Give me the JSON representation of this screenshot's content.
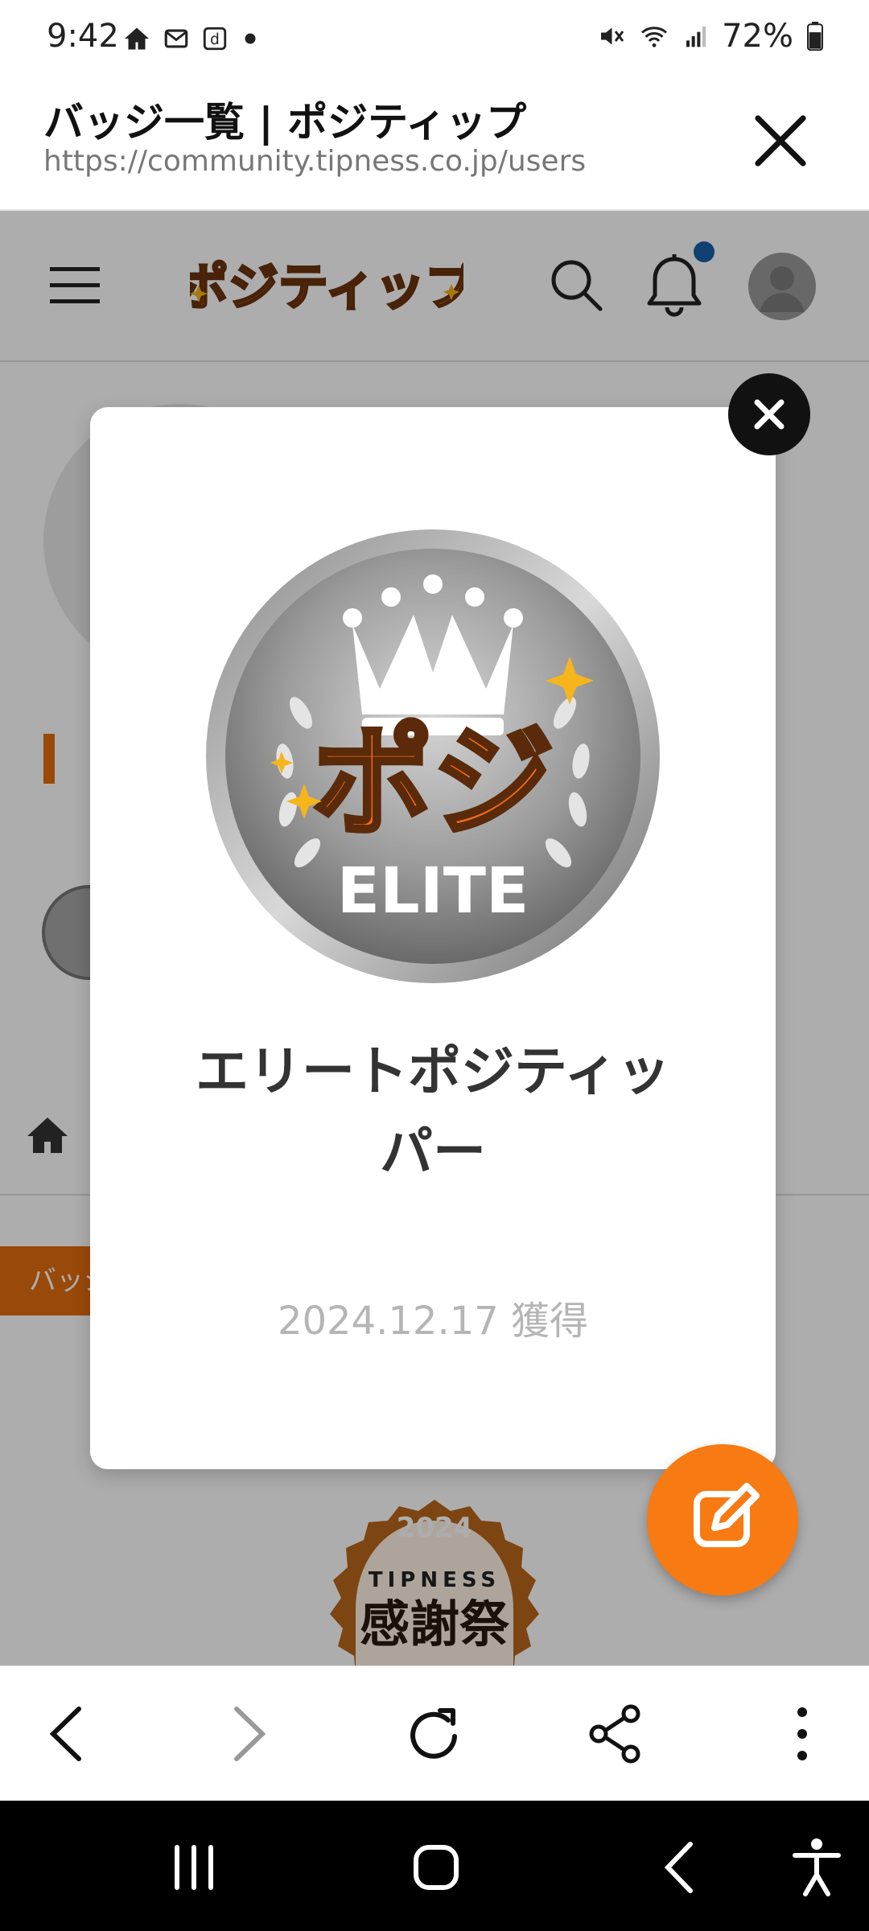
{
  "status_bar": {
    "time": "9:42",
    "battery": "72%",
    "icons_left": [
      "home-icon",
      "mail-icon",
      "docomo-d-icon",
      "dot-icon"
    ],
    "icons_right": [
      "mute-icon",
      "wifi-icon",
      "signal-icon",
      "battery-icon"
    ]
  },
  "tab": {
    "title": "バッジ一覧 | ポジティップ",
    "url": "https://community.tipness.co.jp/users"
  },
  "site": {
    "logo_text": "ポジティップ"
  },
  "background": {
    "tab_pill_label": "バッジ",
    "fest_badge_year": "2024",
    "fest_badge_brand": "TIPNESS",
    "fest_badge_title": "感謝祭"
  },
  "modal": {
    "badge_logo_text": "ポジ",
    "badge_label": "ELITE",
    "badge_name_line1": "エリートポジティッ",
    "badge_name_line2": "パー",
    "earned_date": "2024.12.17 獲得"
  },
  "colors": {
    "accent_orange": "#f77a12",
    "dim_overlay": "rgba(0,0,0,0.32)",
    "notification_dot": "#1560a8"
  }
}
